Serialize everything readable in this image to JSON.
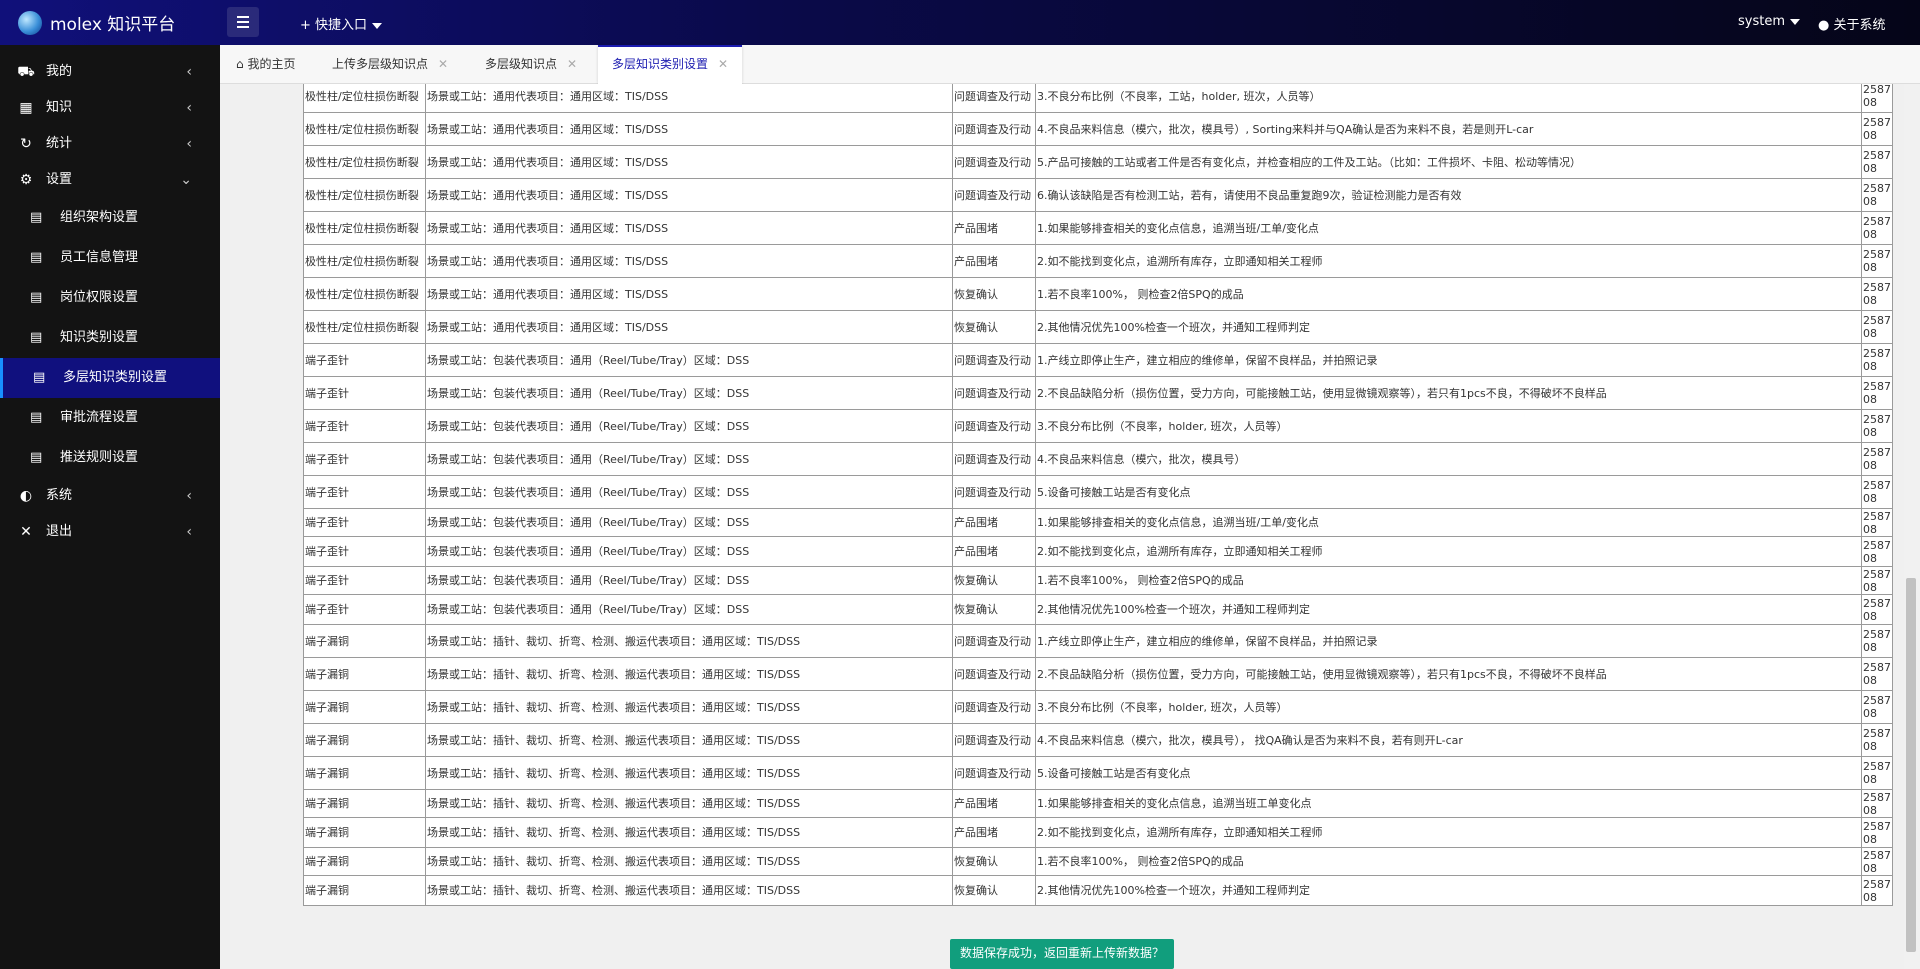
{
  "app": {
    "title": "molex 知识平台"
  },
  "header": {
    "quick_entry": "+ 快捷入口",
    "user": "system",
    "about": "关于系统"
  },
  "sidebar": {
    "items": [
      {
        "label": "我的",
        "icon": "cart-icon"
      },
      {
        "label": "知识",
        "icon": "book-icon"
      },
      {
        "label": "统计",
        "icon": "refresh-icon"
      },
      {
        "label": "设置",
        "icon": "gear-icon"
      }
    ],
    "subitems": [
      {
        "label": "组织架构设置"
      },
      {
        "label": "员工信息管理"
      },
      {
        "label": "岗位权限设置"
      },
      {
        "label": "知识类别设置"
      },
      {
        "label": "多层知识类别设置"
      },
      {
        "label": "审批流程设置"
      },
      {
        "label": "推送规则设置"
      }
    ],
    "bottom_items": [
      {
        "label": "系统",
        "icon": "palette-icon"
      },
      {
        "label": "退出",
        "icon": "close-icon"
      }
    ]
  },
  "tabs": [
    {
      "label": "我的主页"
    },
    {
      "label": "上传多层级知识点"
    },
    {
      "label": "多层级知识点"
    },
    {
      "label": "多层知识类别设置"
    }
  ],
  "table": {
    "rows": [
      {
        "cat": "极性柱/定位柱损伤断裂",
        "scene": "场景或工站：通用代表项目：通用区域：TIS/DSS",
        "type": "问题调查及行动",
        "action": "3.不良分布比例（不良率，工站，holder, 班次，人员等）",
        "id": "258708"
      },
      {
        "cat": "极性柱/定位柱损伤断裂",
        "scene": "场景或工站：通用代表项目：通用区域：TIS/DSS",
        "type": "问题调查及行动",
        "action": "4.不良品来料信息（模穴，批次，模具号）, Sorting来料并与QA确认是否为来料不良，若是则开L-car",
        "id": "258708"
      },
      {
        "cat": "极性柱/定位柱损伤断裂",
        "scene": "场景或工站：通用代表项目：通用区域：TIS/DSS",
        "type": "问题调查及行动",
        "action": "5.产品可接触的工站或者工件是否有变化点，并检查相应的工件及工站。（比如：工件损坏、卡阻、松动等情况）",
        "id": "258708"
      },
      {
        "cat": "极性柱/定位柱损伤断裂",
        "scene": "场景或工站：通用代表项目：通用区域：TIS/DSS",
        "type": "问题调查及行动",
        "action": "6.确认该缺陷是否有检测工站，若有，请使用不良品重复跑9次，验证检测能力是否有效",
        "id": "258708"
      },
      {
        "cat": "极性柱/定位柱损伤断裂",
        "scene": "场景或工站：通用代表项目：通用区域：TIS/DSS",
        "type": "产品围堵",
        "action": "1.如果能够排查相关的变化点信息，追溯当班/工单/变化点",
        "id": "258708"
      },
      {
        "cat": "极性柱/定位柱损伤断裂",
        "scene": "场景或工站：通用代表项目：通用区域：TIS/DSS",
        "type": "产品围堵",
        "action": "2.如不能找到变化点，追溯所有库存，立即通知相关工程师",
        "id": "258708"
      },
      {
        "cat": "极性柱/定位柱损伤断裂",
        "scene": "场景或工站：通用代表项目：通用区域：TIS/DSS",
        "type": "恢复确认",
        "action": "1.若不良率100%， 则检查2倍SPQ的成品",
        "id": "258708"
      },
      {
        "cat": "极性柱/定位柱损伤断裂",
        "scene": "场景或工站：通用代表项目：通用区域：TIS/DSS",
        "type": "恢复确认",
        "action": "2.其他情况优先100%检查一个班次，并通知工程师判定",
        "id": "258708"
      },
      {
        "cat": "端子歪针",
        "scene": "场景或工站：包装代表项目：通用（Reel/Tube/Tray）区域：DSS",
        "type": "问题调查及行动",
        "action": "1.产线立即停止生产，建立相应的维修单，保留不良样品，并拍照记录",
        "id": "258708"
      },
      {
        "cat": "端子歪针",
        "scene": "场景或工站：包装代表项目：通用（Reel/Tube/Tray）区域：DSS",
        "type": "问题调查及行动",
        "action": "2.不良品缺陷分析（损伤位置，受力方向，可能接触工站，使用显微镜观察等），若只有1pcs不良，不得破坏不良样品",
        "id": "258708"
      },
      {
        "cat": "端子歪针",
        "scene": "场景或工站：包装代表项目：通用（Reel/Tube/Tray）区域：DSS",
        "type": "问题调查及行动",
        "action": "3.不良分布比例（不良率，holder, 班次，人员等）",
        "id": "258708"
      },
      {
        "cat": "端子歪针",
        "scene": "场景或工站：包装代表项目：通用（Reel/Tube/Tray）区域：DSS",
        "type": "问题调查及行动",
        "action": "4.不良品来料信息（模穴，批次，模具号）",
        "id": "258708"
      },
      {
        "cat": "端子歪针",
        "scene": "场景或工站：包装代表项目：通用（Reel/Tube/Tray）区域：DSS",
        "type": "问题调查及行动",
        "action": "5.设备可接触工站是否有变化点",
        "id": "258708"
      },
      {
        "cat": "端子歪针",
        "scene": "场景或工站：包装代表项目：通用（Reel/Tube/Tray）区域：DSS",
        "type": "产品围堵",
        "action": "1.如果能够排查相关的变化点信息，追溯当班/工单/变化点",
        "id": "258708"
      },
      {
        "cat": "端子歪针",
        "scene": "场景或工站：包装代表项目：通用（Reel/Tube/Tray）区域：DSS",
        "type": "产品围堵",
        "action": "2.如不能找到变化点，追溯所有库存，立即通知相关工程师",
        "id": "258708"
      },
      {
        "cat": "端子歪针",
        "scene": "场景或工站：包装代表项目：通用（Reel/Tube/Tray）区域：DSS",
        "type": "恢复确认",
        "action": "1.若不良率100%， 则检查2倍SPQ的成品",
        "id": "258708"
      },
      {
        "cat": "端子歪针",
        "scene": "场景或工站：包装代表项目：通用（Reel/Tube/Tray）区域：DSS",
        "type": "恢复确认",
        "action": "2.其他情况优先100%检查一个班次，并通知工程师判定",
        "id": "258708"
      },
      {
        "cat": "端子漏铜",
        "scene": "场景或工站：插针、裁切、折弯、检测、搬运代表项目：通用区域：TIS/DSS",
        "type": "问题调查及行动",
        "action": "1.产线立即停止生产，建立相应的维修单，保留不良样品，并拍照记录",
        "id": "258708"
      },
      {
        "cat": "端子漏铜",
        "scene": "场景或工站：插针、裁切、折弯、检测、搬运代表项目：通用区域：TIS/DSS",
        "type": "问题调查及行动",
        "action": "2.不良品缺陷分析（损伤位置，受力方向，可能接触工站，使用显微镜观察等），若只有1pcs不良，不得破坏不良样品",
        "id": "258708"
      },
      {
        "cat": "端子漏铜",
        "scene": "场景或工站：插针、裁切、折弯、检测、搬运代表项目：通用区域：TIS/DSS",
        "type": "问题调查及行动",
        "action": "3.不良分布比例（不良率，holder, 班次，人员等）",
        "id": "258708"
      },
      {
        "cat": "端子漏铜",
        "scene": "场景或工站：插针、裁切、折弯、检测、搬运代表项目：通用区域：TIS/DSS",
        "type": "问题调查及行动",
        "action": "4.不良品来料信息（模穴，批次，模具号）， 找QA确认是否为来料不良，若有则开L-car",
        "id": "258708"
      },
      {
        "cat": "端子漏铜",
        "scene": "场景或工站：插针、裁切、折弯、检测、搬运代表项目：通用区域：TIS/DSS",
        "type": "问题调查及行动",
        "action": "5.设备可接触工站是否有变化点",
        "id": "258708"
      },
      {
        "cat": "端子漏铜",
        "scene": "场景或工站：插针、裁切、折弯、检测、搬运代表项目：通用区域：TIS/DSS",
        "type": "产品围堵",
        "action": "1.如果能够排查相关的变化点信息，追溯当班工单变化点",
        "id": "258708"
      },
      {
        "cat": "端子漏铜",
        "scene": "场景或工站：插针、裁切、折弯、检测、搬运代表项目：通用区域：TIS/DSS",
        "type": "产品围堵",
        "action": "2.如不能找到变化点，追溯所有库存，立即通知相关工程师",
        "id": "258708"
      },
      {
        "cat": "端子漏铜",
        "scene": "场景或工站：插针、裁切、折弯、检测、搬运代表项目：通用区域：TIS/DSS",
        "type": "恢复确认",
        "action": "1.若不良率100%， 则检查2倍SPQ的成品",
        "id": "258708"
      },
      {
        "cat": "端子漏铜",
        "scene": "场景或工站：插针、裁切、折弯、检测、搬运代表项目：通用区域：TIS/DSS",
        "type": "恢复确认",
        "action": "2.其他情况优先100%检查一个班次，并通知工程师判定",
        "id": "258708"
      }
    ]
  },
  "save_button": "数据保存成功，返回重新上传新数据？",
  "colors": {
    "header_bg": "#10107a",
    "sidebar_bg": "#131313",
    "active_item": "#10107e",
    "save_button": "#119e7d"
  }
}
